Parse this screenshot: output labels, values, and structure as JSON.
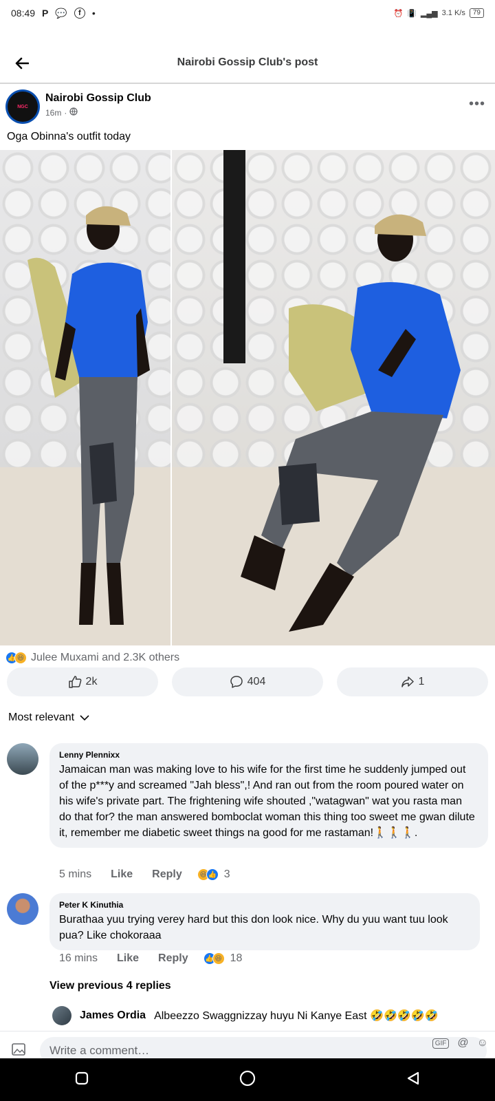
{
  "status_bar": {
    "time": "08:49",
    "network_speed": "3.1 K/s",
    "battery": "79"
  },
  "header": {
    "title": "Nairobi Gossip Club's post"
  },
  "post": {
    "page_name": "Nairobi Gossip Club",
    "time": "16m",
    "caption": "Oga Obinna's outfit today",
    "reactions_summary": "Julee Muxami and 2.3K others",
    "like_count": "2k",
    "comment_count": "404",
    "share_count": "1"
  },
  "sort_label": "Most relevant",
  "comments": [
    {
      "author": "Lenny Plennixx",
      "text": "Jamaican man was making love to his wife for the first time he suddenly jumped out of the p***y and screamed \"Jah bless\",! And ran out from the room poured water on his wife's private part. The frightening wife shouted ,\"watagwan\" wat you rasta man do that for? the man answered bomboclat woman this thing too sweet me gwan dilute it, remember me diabetic sweet things na good for me rastaman!🚶🚶🚶.",
      "time": "5 mins",
      "like_label": "Like",
      "reply_label": "Reply",
      "reaction_count": "3"
    },
    {
      "author": "Peter K Kinuthia",
      "text": "Burathaa yuu trying verey hard but this don look nice. Why du yuu want tuu look pua? Like chokoraaa",
      "time": "16 mins",
      "like_label": "Like",
      "reply_label": "Reply",
      "reaction_count": "18"
    }
  ],
  "view_previous": "View previous 4 replies",
  "reply_preview": {
    "author": "James Ordia",
    "text": "Albeezzo Swaggnizzay huyu Ni Kanye East 🤣🤣🤣🤣🤣"
  },
  "composer": {
    "placeholder": "Write a comment…",
    "gif_label": "GIF"
  }
}
